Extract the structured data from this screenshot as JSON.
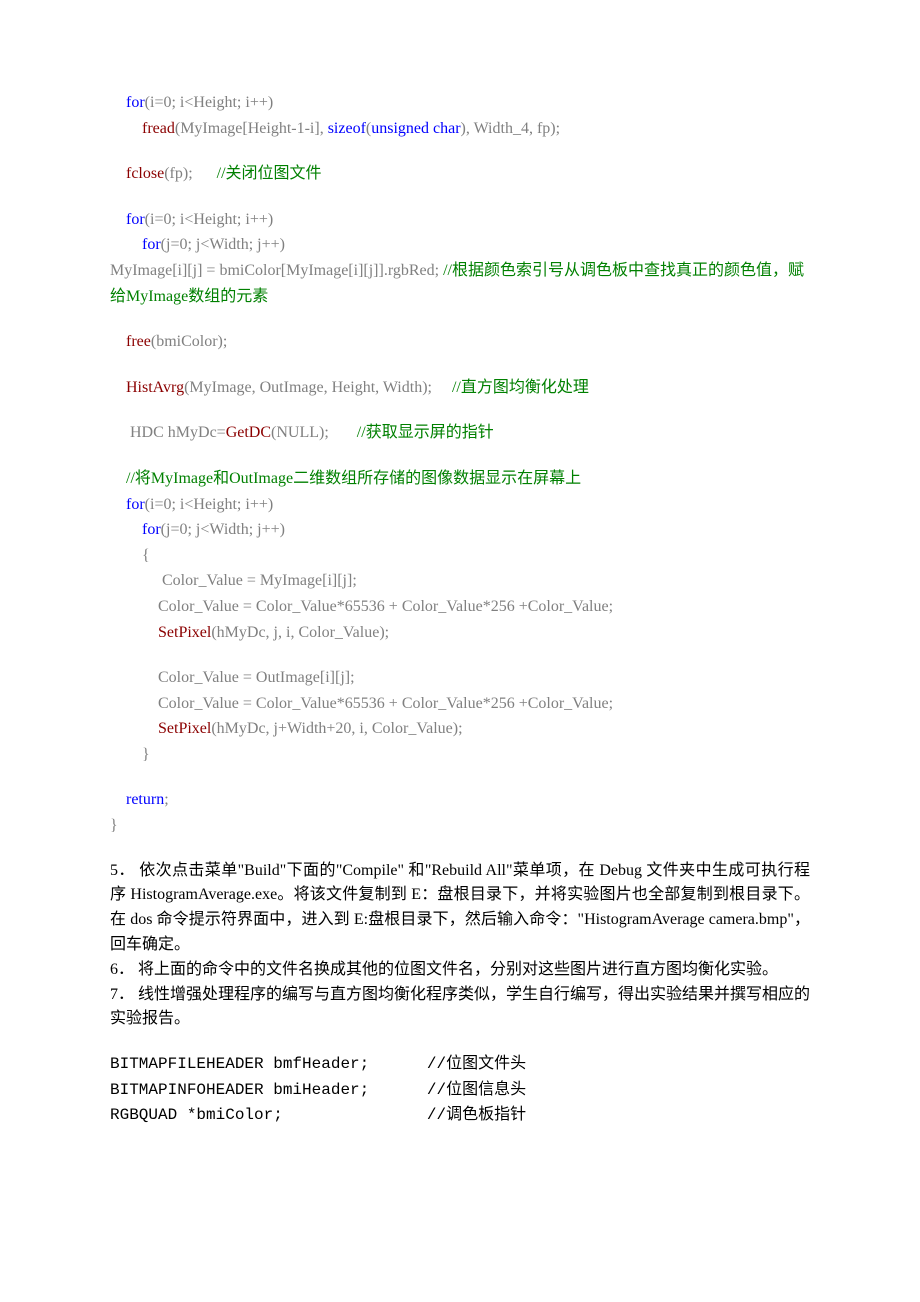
{
  "code": {
    "l1a": "for",
    "l1b": "(i",
    "l1c": "=0",
    "l1d": "; i<Height; i",
    "l1e": "++)",
    "l2a": "fread",
    "l2b": "(MyImage[Height",
    "l2c": "-1-",
    "l2d": "i], ",
    "l2e": "sizeof",
    "l2f": "(",
    "l2g": "unsigned char",
    "l2h": "), Width_4, fp);",
    "l3a": "fclose",
    "l3b": "(fp);",
    "l3c": "//关闭位图文件",
    "l4a": "for",
    "l4b": "(i",
    "l4c": "=0",
    "l4d": "; i<Height; i",
    "l4e": "++)",
    "l5a": "for",
    "l5b": "(j",
    "l5c": "=0",
    "l5d": "; j<Width; j",
    "l5e": "++)",
    "l6a": "MyImage[i][j] ",
    "l6b": "=",
    "l6c": " bmiColor[MyImage[i][j]].rgbRed;",
    "l6d": "//根据颜色索引号从调色板中查找真正的颜色值，赋给MyImage数组的元素",
    "l7a": "free",
    "l7b": "(bmiColor);",
    "l8a": "HistAvrg",
    "l8b": "(MyImage, OutImage, Height, Width);",
    "l8c": "//直方图均衡化处理",
    "l9a": " HDC",
    "l9b": " hMyDc",
    "l9c": "=",
    "l9d": "GetDC",
    "l9e": "(NULL);",
    "l9f": "//获取显示屏的指针",
    "l10": "//将MyImage和OutImage二维数组所存储的图像数据显示在屏幕上",
    "l11a": "for",
    "l11b": "(i",
    "l11c": "=0",
    "l11d": "; i<Height; i",
    "l11e": "++)",
    "l12a": "for",
    "l12b": "(j",
    "l12c": "=0",
    "l12d": "; j<Width; j",
    "l12e": "++)",
    "l13": "{",
    "l14a": " Color_Value ",
    "l14b": "=",
    "l14c": " MyImage[i][j];",
    "l15a": "Color_Value ",
    "l15b": "=",
    "l15c": " Color_Value",
    "l15d": "*65536 +",
    "l15e": " Color_Value",
    "l15f": "*256 +",
    "l15g": "Color_Value;",
    "l16a": "SetPixel",
    "l16b": "(hMyDc, j, i, Color_Value);",
    "l17a": "Color_Value ",
    "l17b": "=",
    "l17c": " OutImage[i][j];",
    "l18a": "Color_Value ",
    "l18b": "=",
    "l18c": " Color_Value",
    "l18d": "*65536 +",
    "l18e": " Color_Value",
    "l18f": "*256 +",
    "l18g": "Color_Value;",
    "l19a": "SetPixel",
    "l19b": "(hMyDc, j",
    "l19c": "+",
    "l19d": "Width",
    "l19e": "+20",
    "l19f": ", i, Color_Value);",
    "l20": "}",
    "l21a": "return",
    "l21b": ";",
    "l22": "}"
  },
  "para": {
    "p5": "5．  依次点击菜单\"Build\"下面的\"Compile\"  和\"Rebuild All\"菜单项，在 Debug 文件夹中生成可执行程序 HistogramAverage.exe。将该文件复制到 E：盘根目录下，并将实验图片也全部复制到根目录下。在 dos 命令提示符界面中，进入到 E:盘根目录下，然后输入命令：\"HistogramAverage camera.bmp\"，回车确定。",
    "p6": "6．  将上面的命令中的文件名换成其他的位图文件名，分别对这些图片进行直方图均衡化实验。",
    "p7": "7．  线性增强处理程序的编写与直方图均衡化程序类似，学生自行编写，得出实验结果并撰写相应的实验报告。"
  },
  "struct": {
    "s1a": "BITMAPFILEHEADER bmfHeader;",
    "s1b": "//位图文件头",
    "s2a": "BITMAPINFOHEADER bmiHeader;",
    "s2b": "//位图信息头",
    "s3a": "RGBQUAD *bmiColor;",
    "s3b": "//调色板指针"
  }
}
